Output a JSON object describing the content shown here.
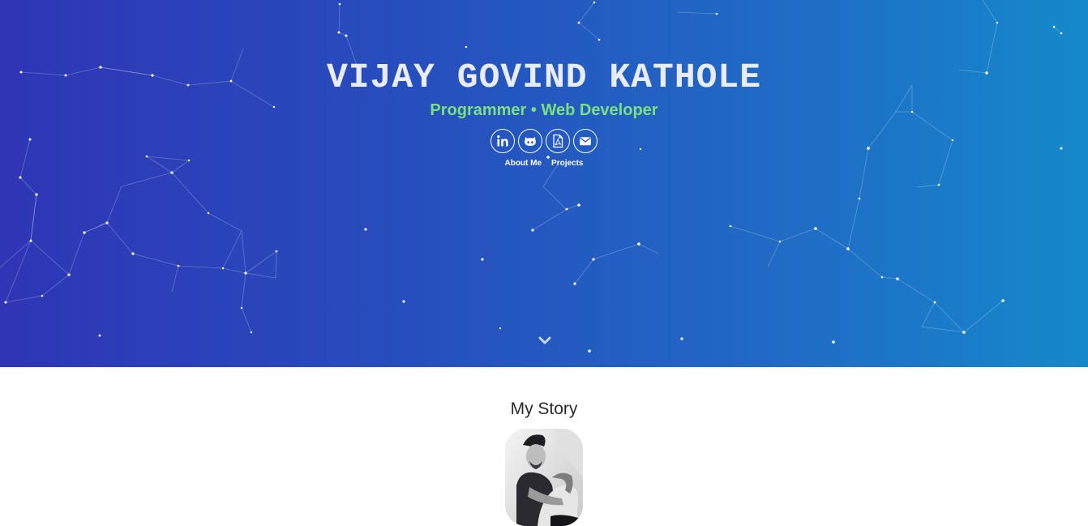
{
  "hero": {
    "title": "VIJAY GOVIND KATHOLE",
    "subtitle": "Programmer • Web Developer",
    "social": [
      {
        "icon": "linkedin-icon"
      },
      {
        "icon": "github-icon"
      },
      {
        "icon": "pdf-icon"
      },
      {
        "icon": "envelope-icon"
      }
    ],
    "nav": {
      "about_label": "About Me",
      "projects_label": "Projects"
    },
    "scroll_icon": "chevron-down-icon"
  },
  "story": {
    "title": "My Story",
    "avatar_icon": "avatar"
  },
  "colors": {
    "gradient_start": "#2f35b5",
    "gradient_end": "#1589cb",
    "subtitle": "#7be07e",
    "title": "#e9ecf5"
  }
}
